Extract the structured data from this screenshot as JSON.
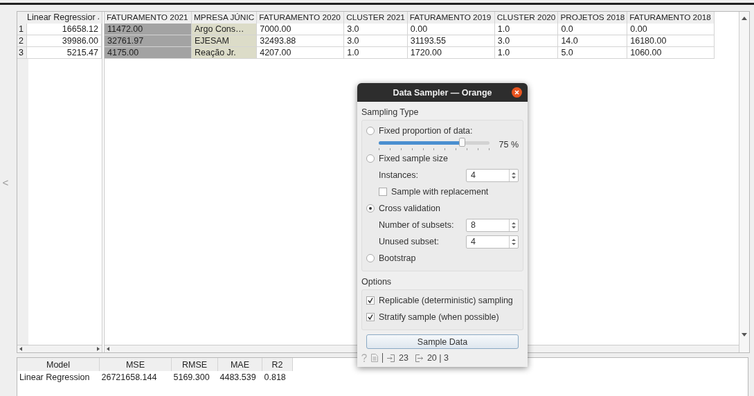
{
  "data_table": {
    "index_column": {
      "header": "Linear Regressior"
    },
    "columns": [
      {
        "header": "FATURAMENTO 2021",
        "color": "#a3a3a3"
      },
      {
        "header": "MPRESA JÚNIC",
        "color": "#dcdcc8"
      },
      {
        "header": "FATURAMENTO 2020"
      },
      {
        "header": "CLUSTER 2021"
      },
      {
        "header": "FATURAMENTO 2019"
      },
      {
        "header": "CLUSTER 2020"
      },
      {
        "header": "PROJETOS 2018"
      },
      {
        "header": "FATURAMENTO 2018"
      }
    ],
    "rows": [
      {
        "index": "1",
        "prediction": "16658.12",
        "cells": [
          "11472.00",
          "Argo Cons…",
          "7000.00",
          "3.0",
          "0.00",
          "1.0",
          "0.0",
          "0.00"
        ]
      },
      {
        "index": "2",
        "prediction": "39986.00",
        "cells": [
          "32761.97",
          "EJESAM",
          "32493.88",
          "3.0",
          "31193.55",
          "3.0",
          "14.0",
          "16180.00"
        ]
      },
      {
        "index": "3",
        "prediction": "5215.47",
        "cells": [
          "4175.00",
          "Reação Jr.",
          "4207.00",
          "1.0",
          "1720.00",
          "1.0",
          "5.0",
          "1060.00"
        ]
      }
    ]
  },
  "side_arrow": "<",
  "dialog": {
    "title": "Data Sampler — Orange",
    "sampling_type": {
      "title": "Sampling Type",
      "options": [
        {
          "kind": "proportion",
          "label": "Fixed proportion of data:",
          "selected": false,
          "level": 0.75,
          "reading": "75 %"
        },
        {
          "kind": "fixed",
          "label": "Fixed sample size",
          "selected": false,
          "fields": [
            {
              "label": "Instances:",
              "value": "4"
            }
          ],
          "checkbox": {
            "label": "Sample with replacement",
            "checked": false
          }
        },
        {
          "kind": "cv",
          "label": "Cross validation",
          "selected": true,
          "fields": [
            {
              "label": "Number of subsets:",
              "value": "8"
            },
            {
              "label": "Unused subset:",
              "value": "4"
            }
          ]
        },
        {
          "kind": "plain",
          "label": "Bootstrap",
          "selected": false
        }
      ]
    },
    "options": {
      "title": "Options",
      "checkboxes": [
        {
          "label": "Replicable (deterministic) sampling",
          "checked": true
        },
        {
          "label": "Stratify sample (when possible)",
          "checked": true
        }
      ]
    },
    "button": "Sample Data",
    "status": {
      "input": "23",
      "output": "20 | 3"
    }
  },
  "results": {
    "columns": [
      "Model",
      "MSE",
      "RMSE",
      "MAE",
      "R2"
    ],
    "rows": [
      [
        "Linear Regression",
        "26721658.144",
        "5169.300",
        "4483.539",
        "0.818"
      ]
    ]
  }
}
